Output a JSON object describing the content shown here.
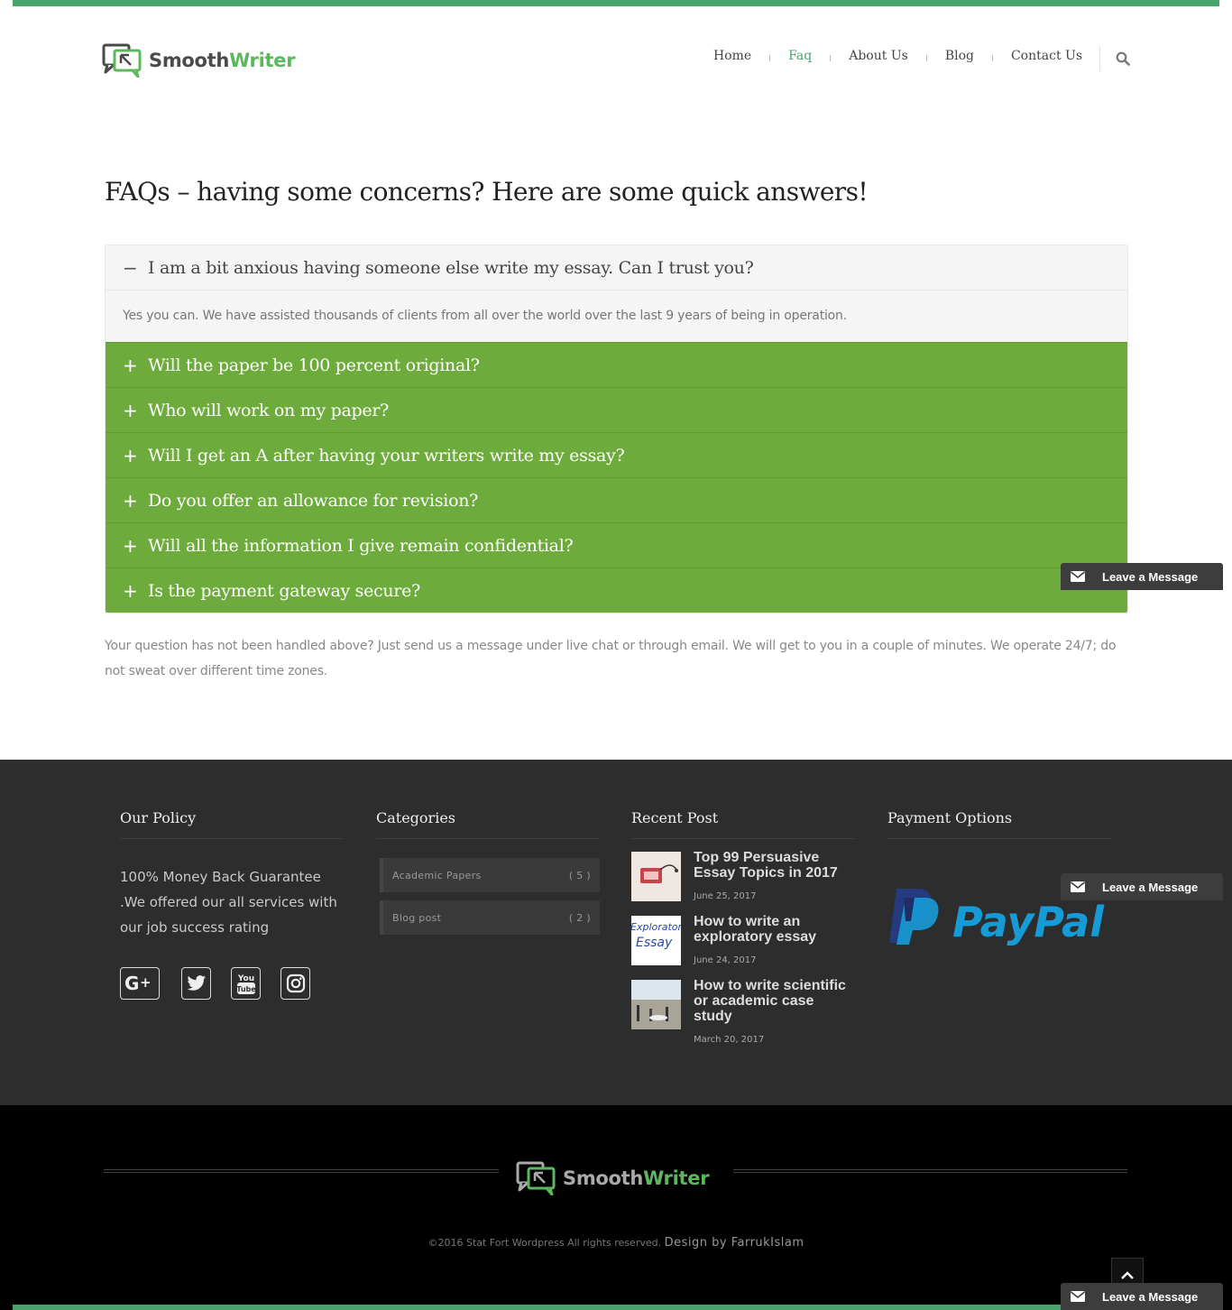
{
  "brand": {
    "name_part1": "Smooth",
    "name_part2": "Writer",
    "accent": "#47a56c",
    "green": "#6dac3c"
  },
  "nav": {
    "items": [
      {
        "label": "Home",
        "active": false
      },
      {
        "label": "Faq",
        "active": true
      },
      {
        "label": "About Us",
        "active": false
      },
      {
        "label": "Blog",
        "active": false
      },
      {
        "label": "Contact Us",
        "active": false
      }
    ],
    "search_icon": "search-icon"
  },
  "main": {
    "title": "FAQs – having some concerns? Here are some quick answers!",
    "open_faq": {
      "sign": "−",
      "question": "I am a bit anxious having someone else write my essay. Can I trust you?",
      "answer": "Yes you can. We have assisted thousands of clients from all over the world over the last 9 years of being in operation."
    },
    "faqs": [
      {
        "sign": "+",
        "question": "Will the paper be 100 percent original?"
      },
      {
        "sign": "+",
        "question": "Who will work on my paper?"
      },
      {
        "sign": "+",
        "question": "Will I get an A after having your writers write my essay?"
      },
      {
        "sign": "+",
        "question": "Do you offer an allowance for revision?"
      },
      {
        "sign": "+",
        "question": "Will all the information I give remain confidential?"
      },
      {
        "sign": "+",
        "question": "Is the payment gateway secure?"
      }
    ],
    "note": "Your question has not been handled above? Just send us a message under live chat or through email. We will get to you in a couple of minutes. We operate 24/7; do not sweat over different time zones."
  },
  "footer": {
    "policy": {
      "heading": "Our Policy",
      "text": "100% Money Back Guarantee .We offered our all services with our job success rating",
      "social": [
        "google-plus-icon",
        "twitter-icon",
        "youtube-icon",
        "instagram-icon"
      ],
      "youtube_text_1": "You",
      "youtube_text_2": "Tube"
    },
    "categories": {
      "heading": "Categories",
      "items": [
        {
          "label": "Academic Papers",
          "count": "( 5 )"
        },
        {
          "label": "Blog post",
          "count": "( 2 )"
        }
      ]
    },
    "recent": {
      "heading": "Recent Post",
      "posts": [
        {
          "title": "Top 99 Persuasive Essay Topics in 2017",
          "date": "June 25, 2017"
        },
        {
          "title": "How to write an exploratory essay",
          "date": "June 24, 2017",
          "thumb_text_1": "Exploratory",
          "thumb_text_2": "Essay"
        },
        {
          "title": "How to write scientific or academic case study",
          "date": "March 20, 2017"
        }
      ]
    },
    "payment": {
      "heading": "Payment Options",
      "logo_text": "PayPal"
    }
  },
  "bottom": {
    "copyright": "©2016 Stat Fort Wordpress All rights reserved.",
    "design": "Design by FarrukIslam"
  },
  "widget": {
    "label": "Leave a Message"
  }
}
